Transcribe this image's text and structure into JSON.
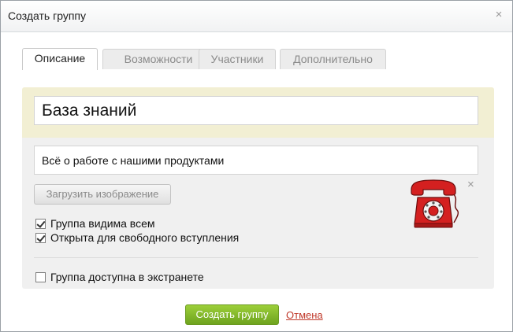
{
  "dialog": {
    "title": "Создать группу",
    "close_icon": "close-icon"
  },
  "tabs": [
    {
      "label": "Описание",
      "active": true
    },
    {
      "label": "Возможности",
      "active": false
    },
    {
      "label": "Участники",
      "active": false
    },
    {
      "label": "Дополнительно",
      "active": false
    }
  ],
  "form": {
    "name_value": "База знаний",
    "description_value": "Всё о работе с нашими продуктами",
    "upload_label": "Загрузить изображение",
    "image_icon": "red-telephone-icon",
    "remove_image_icon": "close-icon",
    "options": [
      {
        "label": "Группа видима всем",
        "checked": true
      },
      {
        "label": "Открыта для свободного вступления",
        "checked": true
      }
    ],
    "extranet": {
      "label": "Группа доступна в экстранете",
      "checked": false
    }
  },
  "footer": {
    "create_label": "Создать группу",
    "cancel_label": "Отмена"
  },
  "colors": {
    "primary_button": "#8bc12f",
    "cancel_link": "#c0392b",
    "header_panel": "#f2efd3",
    "body_panel": "#f0f0f0",
    "phone": "#d42020"
  }
}
